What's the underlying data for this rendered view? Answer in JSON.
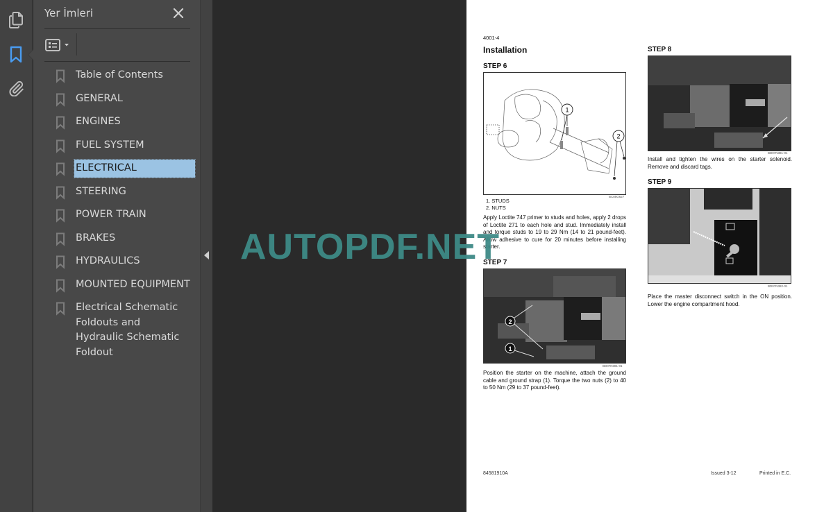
{
  "rail": {
    "items": [
      {
        "name": "pages-thumbnails",
        "icon": "pages-icon",
        "active": false
      },
      {
        "name": "bookmarks",
        "icon": "bookmark-icon",
        "active": true
      },
      {
        "name": "attachments",
        "icon": "paperclip-icon",
        "active": false
      }
    ],
    "accent_color": "#4a9cf0"
  },
  "panel": {
    "title": "Yer İmleri",
    "close_icon": "close-icon",
    "options_icon": "bookmark-options-icon",
    "bookmarks": [
      {
        "label": "Table of Contents",
        "selected": false
      },
      {
        "label": "GENERAL",
        "selected": false
      },
      {
        "label": "ENGINES",
        "selected": false
      },
      {
        "label": "FUEL SYSTEM",
        "selected": false
      },
      {
        "label": "ELECTRICAL",
        "selected": true
      },
      {
        "label": "STEERING",
        "selected": false
      },
      {
        "label": "POWER TRAIN",
        "selected": false
      },
      {
        "label": "BRAKES",
        "selected": false
      },
      {
        "label": "HYDRAULICS",
        "selected": false
      },
      {
        "label": "MOUNTED EQUIPMENT",
        "selected": false
      },
      {
        "label": "Electrical Schematic Foldouts and Hydraulic Schematic Foldout",
        "selected": false
      }
    ],
    "selection_color": "#9bc3e3"
  },
  "document": {
    "section_code": "4001-4",
    "heading": "Installation",
    "steps": [
      {
        "title": "STEP 6",
        "figure_code": "BC85G627",
        "legend": [
          "1. STUDS",
          "2. NUTS"
        ],
        "text": "Apply Loctite 747 primer to studs and holes, apply 2 drops of Loctite 271 to each hole and stud. Immediately install and torque studs to 19 to 29 Nm (14 to 21 pound-feet). Allow adhesive to cure for 20 minutes before installing starter."
      },
      {
        "title": "STEP 7",
        "figure_code": "BD07N381-01",
        "text": "Position the starter on the machine, attach the ground cable and ground strap (1). Torque the two nuts (2) to 40 to 50 Nm (29 to 37 pound-feet)."
      },
      {
        "title": "STEP 8",
        "figure_code": "BD07N381-01",
        "text": "Install and tighten the wires on the starter solenoid. Remove and discard tags."
      },
      {
        "title": "STEP 9",
        "figure_code": "BD07N382-01",
        "text": "Place the master disconnect switch in the ON position. Lower the engine compartment hood."
      }
    ],
    "footer": {
      "part_number": "84581910A",
      "issued": "Issued  3-12",
      "printed": "Printed in E.C."
    }
  },
  "watermark": {
    "text": "AUTOPDF.NET",
    "color": "#3e8a86"
  }
}
